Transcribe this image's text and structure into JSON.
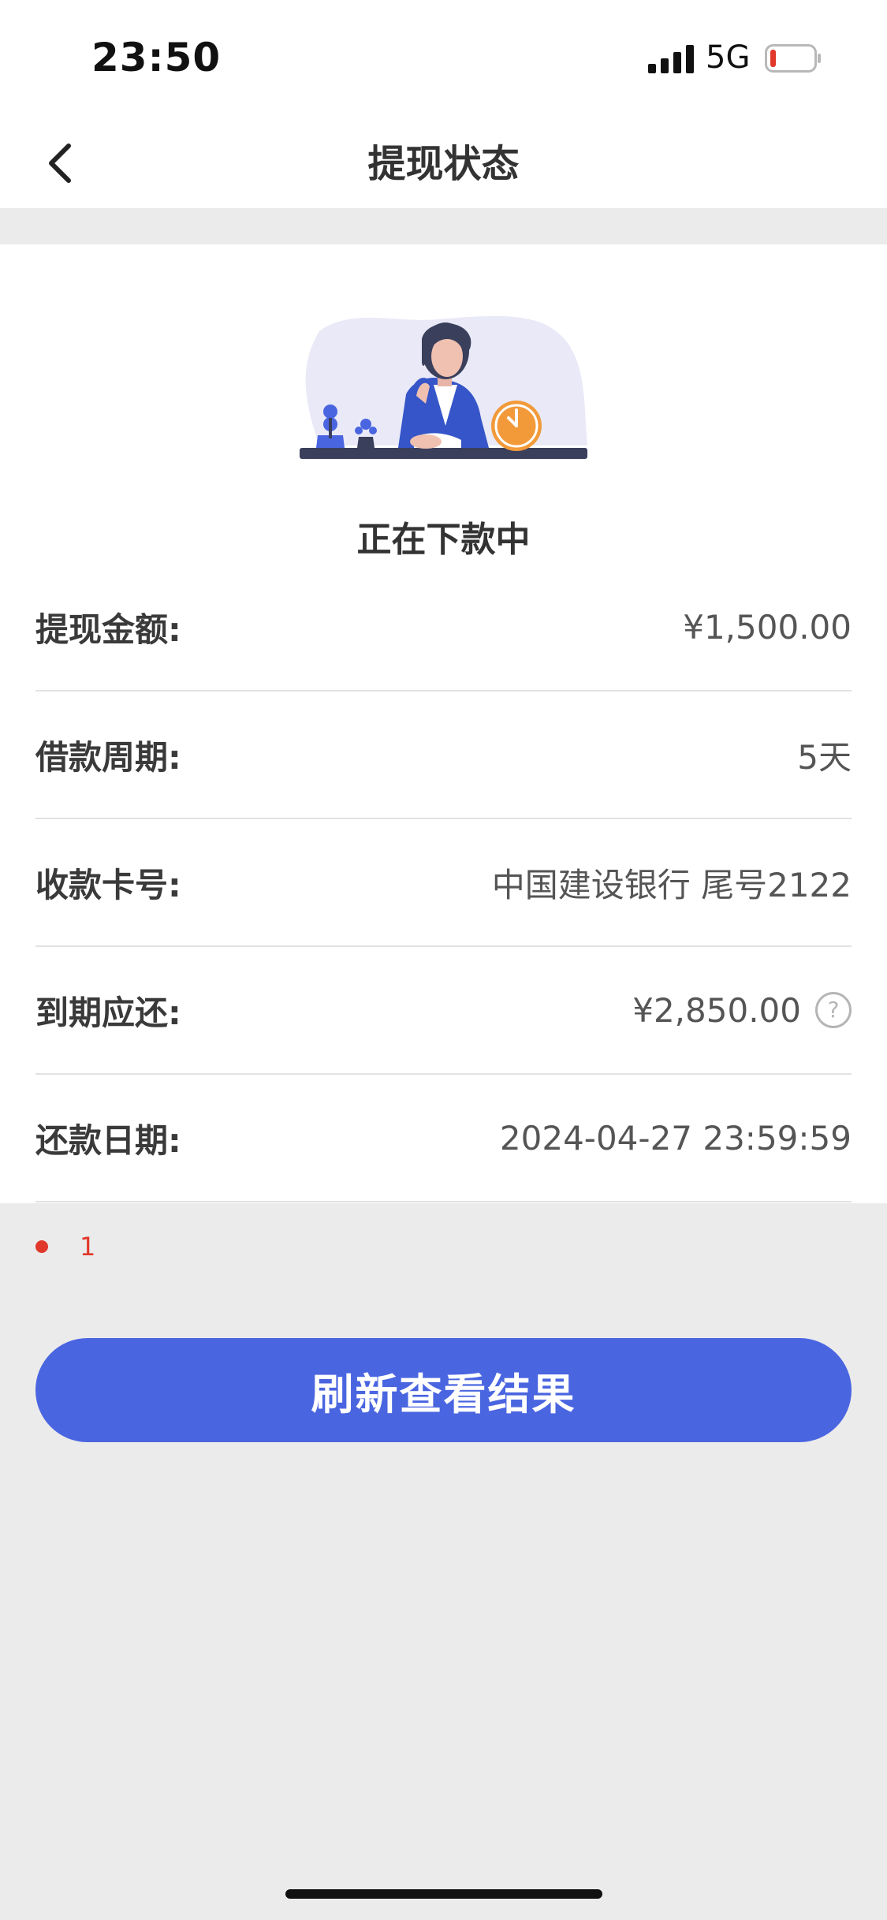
{
  "status_bar": {
    "time": "23:50",
    "network": "5G",
    "signal_icon": "signal-bars-icon",
    "battery_icon": "battery-low-icon"
  },
  "nav": {
    "title": "提现状态",
    "back_icon": "chevron-left-icon"
  },
  "status": {
    "illustration_icon": "woman-waiting-clock-illustration",
    "text": "正在下款中"
  },
  "details": [
    {
      "label": "提现金额:",
      "value": "¥1,500.00"
    },
    {
      "label": "借款周期:",
      "value": "5天"
    },
    {
      "label": "收款卡号:",
      "value": "中国建设银行 尾号2122"
    },
    {
      "label": "到期应还:",
      "value": "¥2,850.00"
    },
    {
      "label": "还款日期:",
      "value": "2024-04-27 23:59:59"
    }
  ],
  "help_icon_label": "?",
  "notice": "1",
  "refresh_button": "刷新查看结果",
  "colors": {
    "accent": "#4a65e0",
    "notice": "#e0382b",
    "background": "#ebebeb"
  }
}
